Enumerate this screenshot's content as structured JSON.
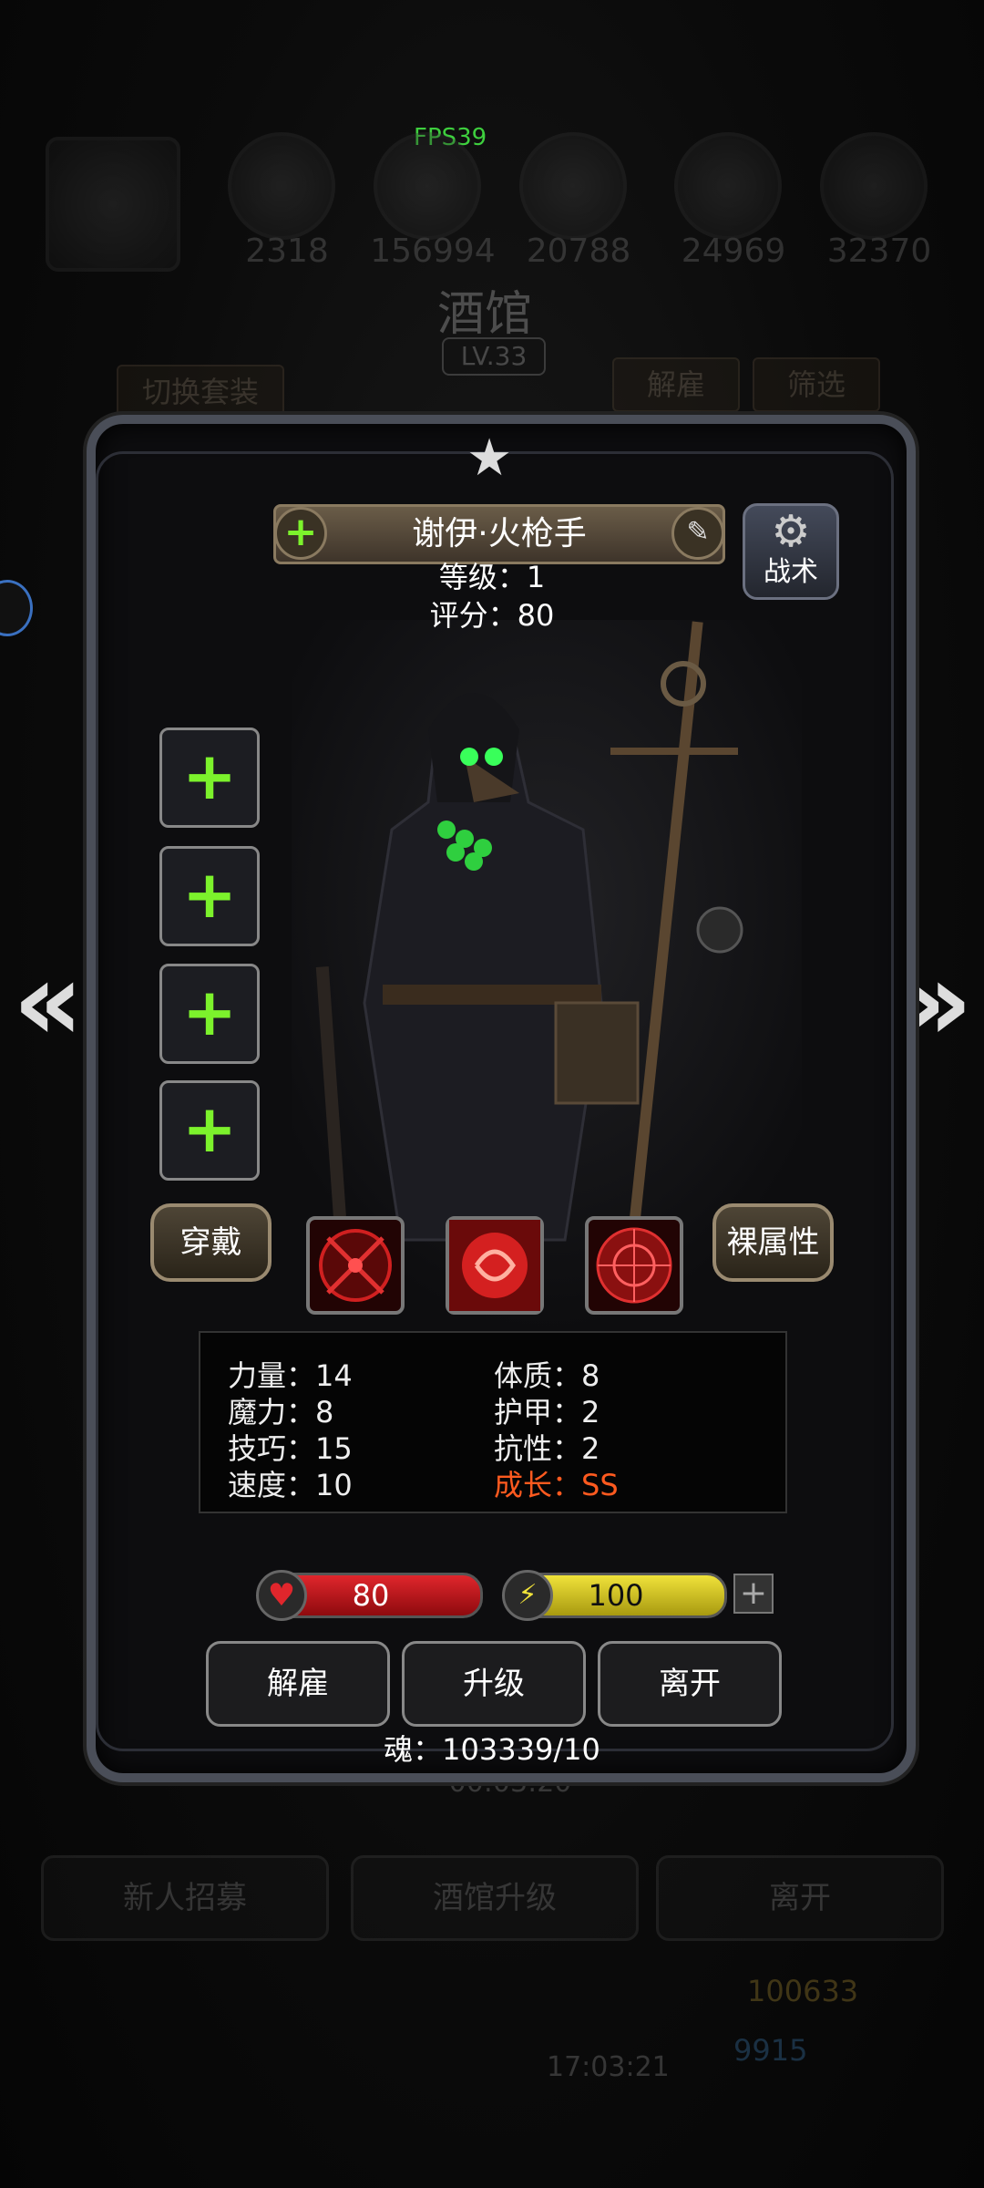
{
  "fps": "FPS39",
  "resources": [
    "2318",
    "156994",
    "20788",
    "24969",
    "32370"
  ],
  "tavern": {
    "title": "酒馆",
    "level": "LV.33",
    "switch_outfit": "切换套装",
    "dismiss": "解雇",
    "filter": "筛选",
    "timer": "00:03:20",
    "recruit": "新人招募",
    "upgrade": "酒馆升级",
    "leave": "离开",
    "currency1": "100633",
    "currency2": "9915",
    "clock": "17:03:21"
  },
  "hero": {
    "name": "谢伊·火枪手",
    "level_label": "等级：1",
    "score_label": "评分：80",
    "tactics": "战术",
    "equip": "穿戴",
    "naked_attr": "裸属性",
    "stats": {
      "strength": "力量：14",
      "magic": "魔力：8",
      "skill": "技巧：15",
      "speed": "速度：10",
      "constitution": "体质：8",
      "armor": "护甲：2",
      "resist": "抗性：2",
      "growth": "成长：SS"
    },
    "hp": "80",
    "energy": "100",
    "soul": "魂：103339/10"
  },
  "actions": {
    "dismiss": "解雇",
    "upgrade": "升级",
    "leave": "离开"
  },
  "colors": {
    "accent_green": "#7cf22c",
    "growth_orange": "#ff5a1f",
    "hp_red": "#c3161c",
    "energy_yellow": "#e3d21a"
  }
}
